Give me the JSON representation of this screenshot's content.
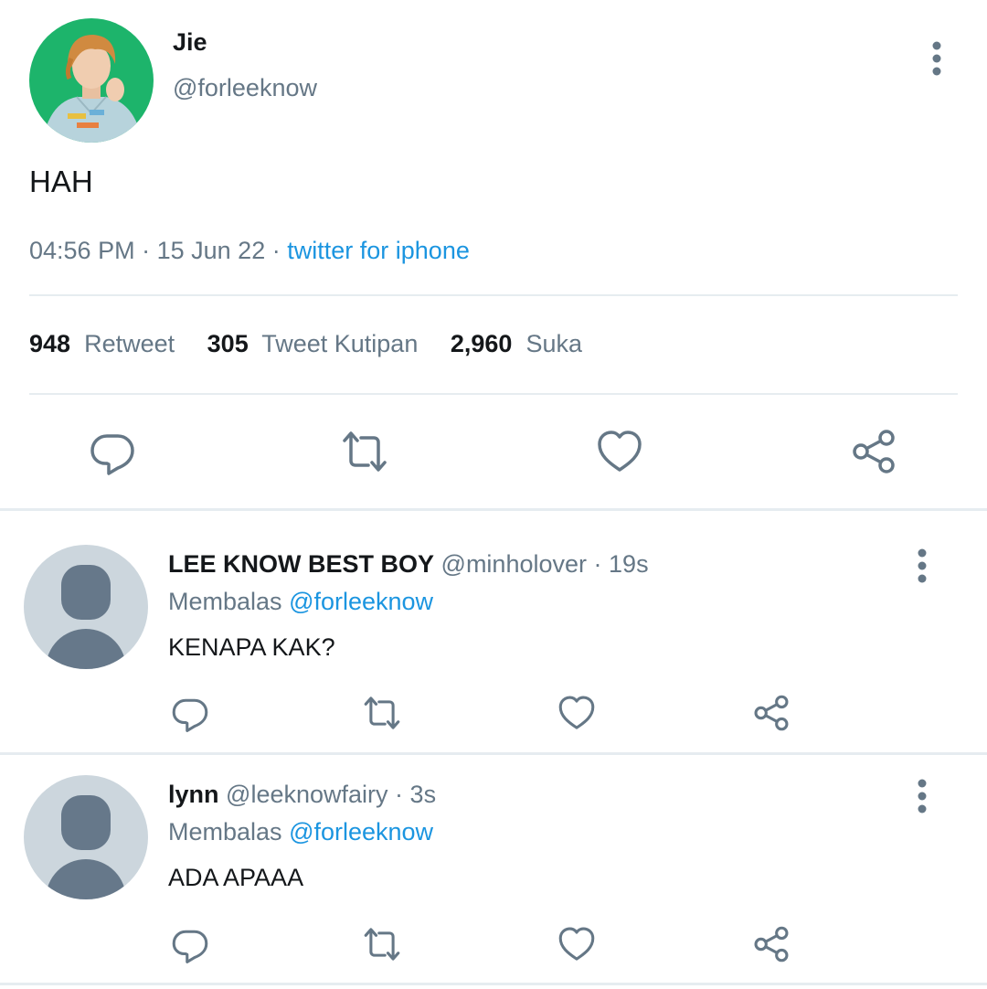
{
  "tweet": {
    "author_name": "Jie",
    "author_handle": "@forleeknow",
    "text": "HAH",
    "time": "04:56 PM",
    "date": "15 Jun 22",
    "source": "twitter for iphone",
    "separator": "·",
    "stats": {
      "retweets_count": "948",
      "retweets_label": "Retweet",
      "quotes_count": "305",
      "quotes_label": "Tweet Kutipan",
      "likes_count": "2,960",
      "likes_label": "Suka"
    }
  },
  "replies": [
    {
      "name": "LEE KNOW BEST BOY",
      "handle": "@minholover",
      "time": "19s",
      "replying_prefix": "Membalas",
      "replying_to": "@forleeknow",
      "text": "KENAPA KAK?"
    },
    {
      "name": "lynn",
      "handle": "@leeknowfairy",
      "time": "3s",
      "replying_prefix": "Membalas",
      "replying_to": "@forleeknow",
      "text": "ADA APAAA"
    }
  ],
  "colors": {
    "accent": "#1b95e0",
    "secondary_text": "#657786",
    "icon": "#657786",
    "divider": "#e6ecf0",
    "avatar_placeholder": "#ccd6dd",
    "avatar_background": "#1db46b"
  },
  "icons": {
    "reply": "speech-bubble-icon",
    "retweet": "retweet-arrows-icon",
    "like": "heart-outline-icon",
    "share": "share-nodes-icon",
    "more": "vertical-dots-icon"
  }
}
